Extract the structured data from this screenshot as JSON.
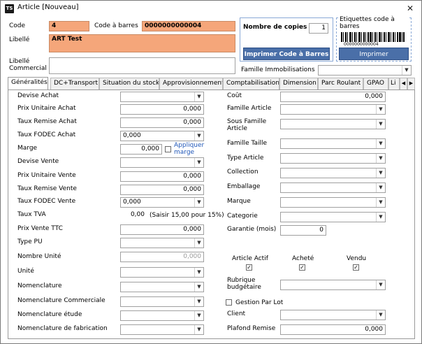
{
  "window": {
    "title": "Article [Nouveau]",
    "icon": "TS",
    "close": "✕"
  },
  "header": {
    "code_label": "Code",
    "code_value": "4",
    "barcode_label": "Code à barres",
    "barcode_value": "0000000000004",
    "libelle_label": "Libellé",
    "libelle_value": "ART Test",
    "libelle_commercial_label": "Libellé\nCommercial",
    "libelle_commercial_value": "",
    "copies_label": "Nombre de copies",
    "copies_value": "1",
    "print_barcode_button": "Imprimer Code à Barres",
    "etiquettes_label": "Etiquettes code à barres",
    "barcode_digits": "0000000000004",
    "print_button": "Imprimer",
    "famille_immo_label": "Famille Immobilisations",
    "famille_immo_value": ""
  },
  "tabs": [
    {
      "label": "Généralités",
      "active": true
    },
    {
      "label": "DC+Transport"
    },
    {
      "label": "Situation du stock"
    },
    {
      "label": "Approvisionnement"
    },
    {
      "label": "Comptabilisation"
    },
    {
      "label": "Dimension"
    },
    {
      "label": "Parc Roulant"
    },
    {
      "label": "GPAO"
    },
    {
      "label": "Li"
    }
  ],
  "left": {
    "devise_achat": {
      "label": "Devise Achat",
      "value": ""
    },
    "prix_unitaire_achat": {
      "label": "Prix Unitaire Achat",
      "value": "0,000"
    },
    "taux_remise_achat": {
      "label": "Taux Remise Achat",
      "value": "0,000"
    },
    "taux_fodec_achat": {
      "label": "Taux FODEC Achat",
      "value": "0,000"
    },
    "marge": {
      "label": "Marge",
      "value": "0,000",
      "appliquer": "Appliquer marge"
    },
    "devise_vente": {
      "label": "Devise Vente",
      "value": ""
    },
    "prix_unitaire_vente": {
      "label": "Prix Unitaire Vente",
      "value": "0,000"
    },
    "taux_remise_vente": {
      "label": "Taux Remise Vente",
      "value": "0,000"
    },
    "taux_fodec_vente": {
      "label": "Taux FODEC Vente",
      "value": "0,000"
    },
    "taux_tva": {
      "label": "Taux TVA",
      "value": "0,00",
      "hint": "(Saisir 15,00 pour 15%)"
    },
    "prix_vente_ttc": {
      "label": "Prix Vente TTC",
      "value": "0,000"
    },
    "type_pu": {
      "label": "Type PU",
      "value": ""
    },
    "nombre_unite": {
      "label": "Nombre Unité",
      "value": "0,000"
    },
    "unite": {
      "label": "Unité",
      "value": ""
    },
    "nomenclature": {
      "label": "Nomenclature",
      "value": ""
    },
    "nomenclature_commerciale": {
      "label": "Nomenclature Commerciale",
      "value": ""
    },
    "nomenclature_etude": {
      "label": "Nomenclature étude",
      "value": ""
    },
    "nomenclature_fabrication": {
      "label": "Nomenclature de fabrication",
      "value": ""
    }
  },
  "right": {
    "cout": {
      "label": "Coût",
      "value": "0,000"
    },
    "famille_article": {
      "label": "Famille Article",
      "value": ""
    },
    "sous_famille_article": {
      "label": "Sous Famille\nArticle",
      "value": ""
    },
    "famille_taille": {
      "label": "Famille Taille",
      "value": ""
    },
    "type_article": {
      "label": "Type Article",
      "value": ""
    },
    "collection": {
      "label": "Collection",
      "value": ""
    },
    "emballage": {
      "label": "Emballage",
      "value": ""
    },
    "marque": {
      "label": "Marque",
      "value": ""
    },
    "categorie": {
      "label": "Categorie",
      "value": ""
    },
    "garantie": {
      "label": "Garantie (mois)",
      "value": "0"
    },
    "article_actif": {
      "label": "Article Actif",
      "checked": true
    },
    "achete": {
      "label": "Acheté",
      "checked": true
    },
    "vendu": {
      "label": "Vendu",
      "checked": true
    },
    "rubrique_budgetaire": {
      "label": "Rubrique\nbudgétaire",
      "value": ""
    },
    "gestion_par_lot": {
      "label": "Gestion Par Lot",
      "checked": false
    },
    "client": {
      "label": "Client",
      "value": ""
    },
    "plafond_remise": {
      "label": "Plafond Remise",
      "value": "0,000"
    }
  }
}
